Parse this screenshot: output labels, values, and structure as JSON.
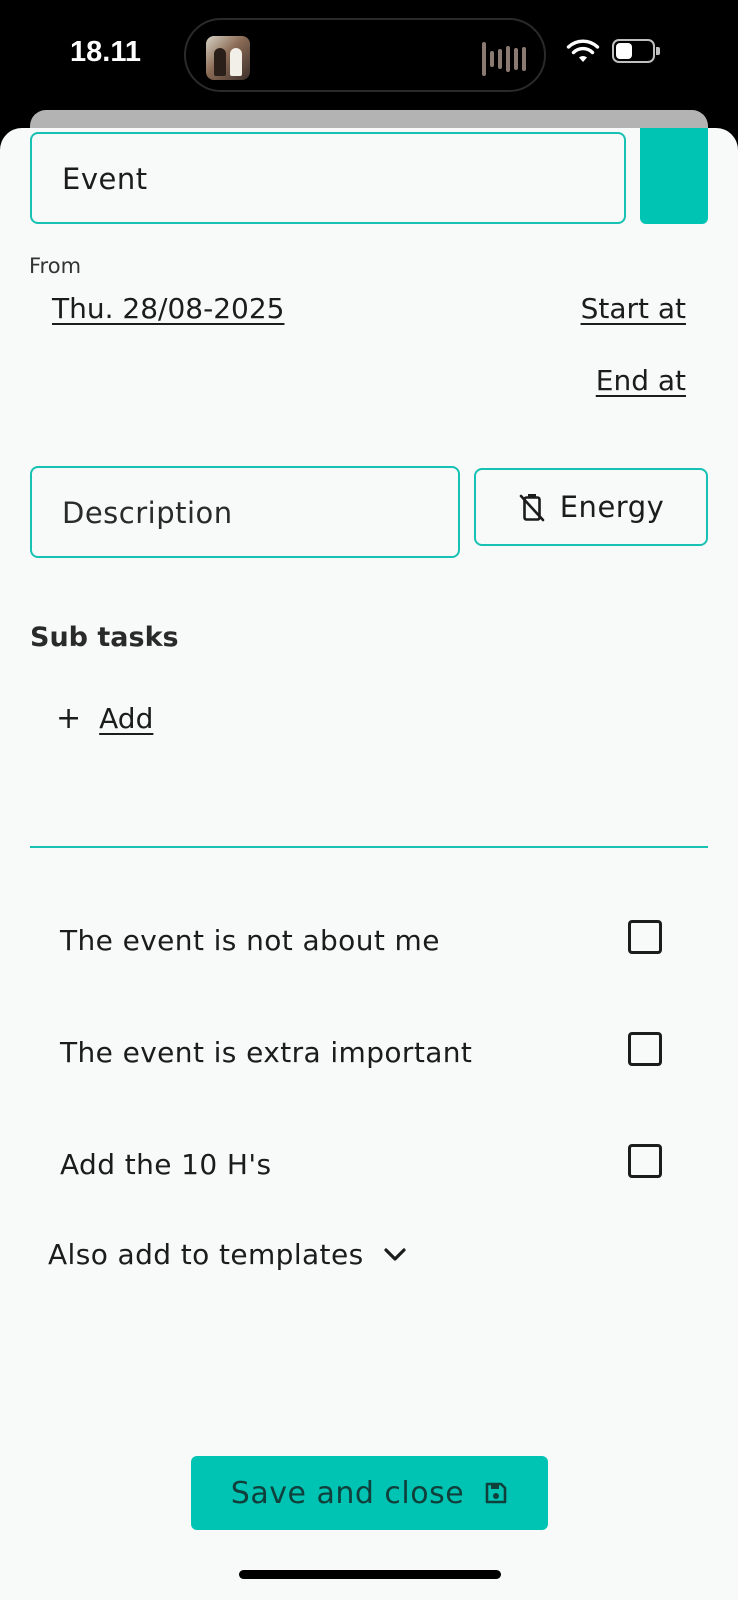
{
  "status_bar": {
    "time": "18.11",
    "now_playing_icon": "album-thumbnail",
    "waveform_icon": "audio-waveform-icon",
    "wifi_icon": "wifi-icon",
    "battery_icon": "battery-icon",
    "battery_level": 0.45
  },
  "form": {
    "title_value": "Event",
    "color_accent": "#00c4b3",
    "from_label": "From",
    "date_value": "Thu. 28/08-2025",
    "start_label": "Start at",
    "end_label": "End at",
    "description_placeholder": "Description",
    "energy_label": "Energy",
    "energy_icon": "battery-off-icon"
  },
  "subtasks": {
    "heading": "Sub tasks",
    "add_label": "Add",
    "add_icon": "plus-icon"
  },
  "options": [
    {
      "label": "The event is not about me",
      "checked": false
    },
    {
      "label": "The event is extra important",
      "checked": false
    },
    {
      "label": "Add the 10 H's",
      "checked": false
    }
  ],
  "templates": {
    "label": "Also add to templates",
    "icon": "chevron-down-icon"
  },
  "footer": {
    "save_label": "Save and close",
    "save_icon": "floppy-disk-icon"
  },
  "colors": {
    "accent": "#00c4b3",
    "border": "#17c1b3",
    "background": "#f8f9f9",
    "text": "#1c1c1c"
  }
}
